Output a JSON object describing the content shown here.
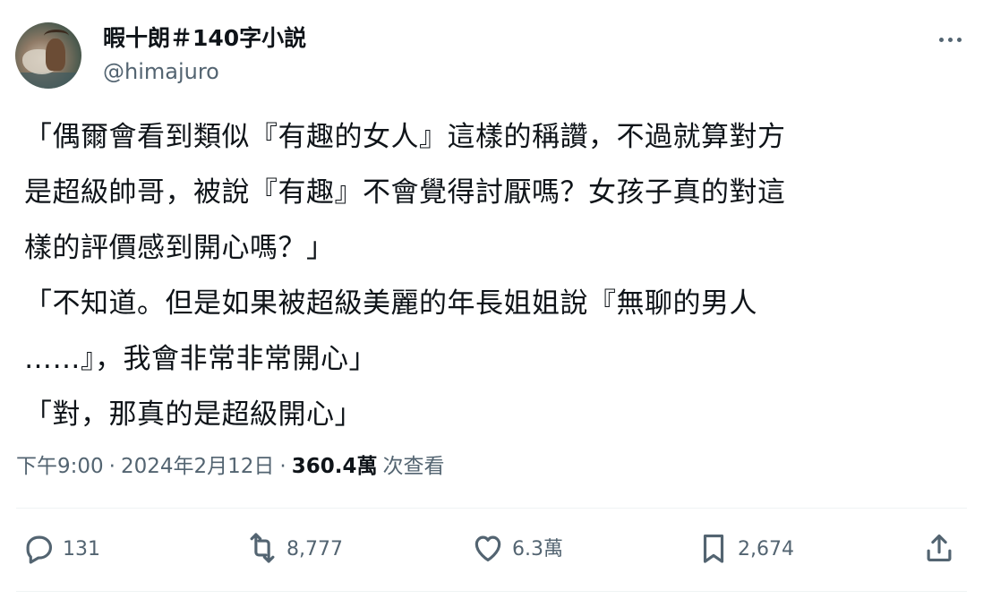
{
  "author": {
    "display_name": "暇十朗＃140字小説",
    "handle": "@himajuro"
  },
  "post": {
    "lines": [
      "「偶爾會看到類似『有趣的女人』這樣的稱讚，不過就算對方",
      "是超級帥哥，被說『有趣』不會覺得討厭嗎？女孩子真的對這",
      "樣的評價感到開心嗎？」",
      "「不知道。但是如果被超級美麗的年長姐姐說『無聊的男人",
      "……』，我會非常非常開心」",
      "「對，那真的是超級開心」"
    ]
  },
  "meta": {
    "time": "下午9:00",
    "separator": "·",
    "date": "2024年2月12日",
    "views_count": "360.4萬",
    "views_label": "次查看"
  },
  "actions": {
    "reply_icon": "reply-icon",
    "reply_count": "131",
    "retweet_icon": "retweet-icon",
    "retweet_count": "8,777",
    "like_icon": "heart-icon",
    "like_count": "6.3萬",
    "bookmark_icon": "bookmark-icon",
    "bookmark_count": "2,674",
    "share_icon": "share-icon"
  },
  "colors": {
    "text_primary": "#0f1419",
    "text_secondary": "#536471",
    "divider": "#eff3f4",
    "background": "#ffffff"
  }
}
